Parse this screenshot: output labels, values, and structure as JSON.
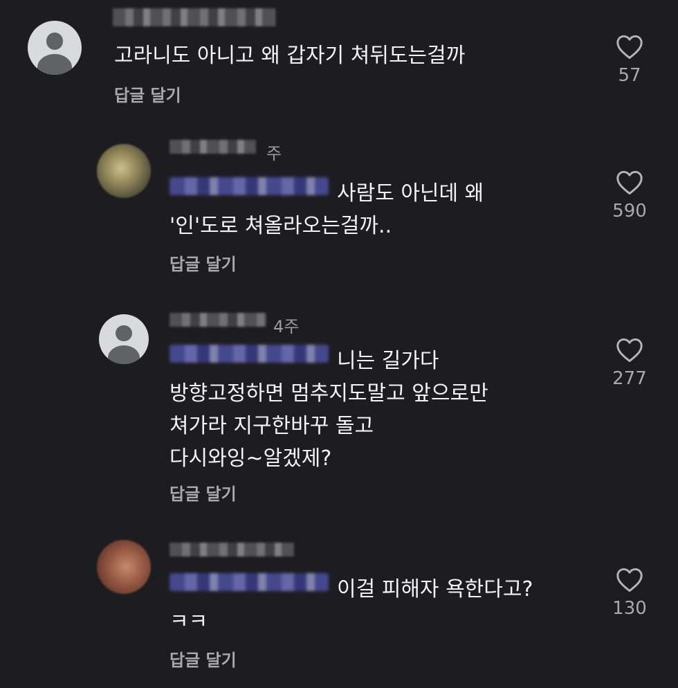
{
  "comments": [
    {
      "time": "",
      "text": "고라니도 아니고 왜 갑자기 쳐뒤도는걸까",
      "reply_label": "답글 달기",
      "likes": "57",
      "avatar": "default-avatar-icon"
    },
    {
      "time": "주",
      "text": "사람도 아닌데 왜\n'인'도로 쳐올라오는걸까..",
      "reply_label": "답글 달기",
      "likes": "590",
      "avatar": "blurred-photo"
    },
    {
      "time": "4주",
      "text": "니는 길가다\n방향고정하면 멈추지도말고 앞으로만\n쳐가라 지구한바꾸 돌고\n다시와잉~알겠제?",
      "reply_label": "답글 달기",
      "likes": "277",
      "avatar": "default-avatar-icon"
    },
    {
      "time": "",
      "text": "이걸 피해자 욕한다고?\nㅋㅋ",
      "reply_label": "답글 달기",
      "likes": "130",
      "avatar": "blurred-photo"
    }
  ],
  "colors": {
    "background": "#1d1d21",
    "text": "#f4f4f4",
    "muted": "#a9a9ae"
  },
  "icons": {
    "like": "heart-outline-icon"
  }
}
